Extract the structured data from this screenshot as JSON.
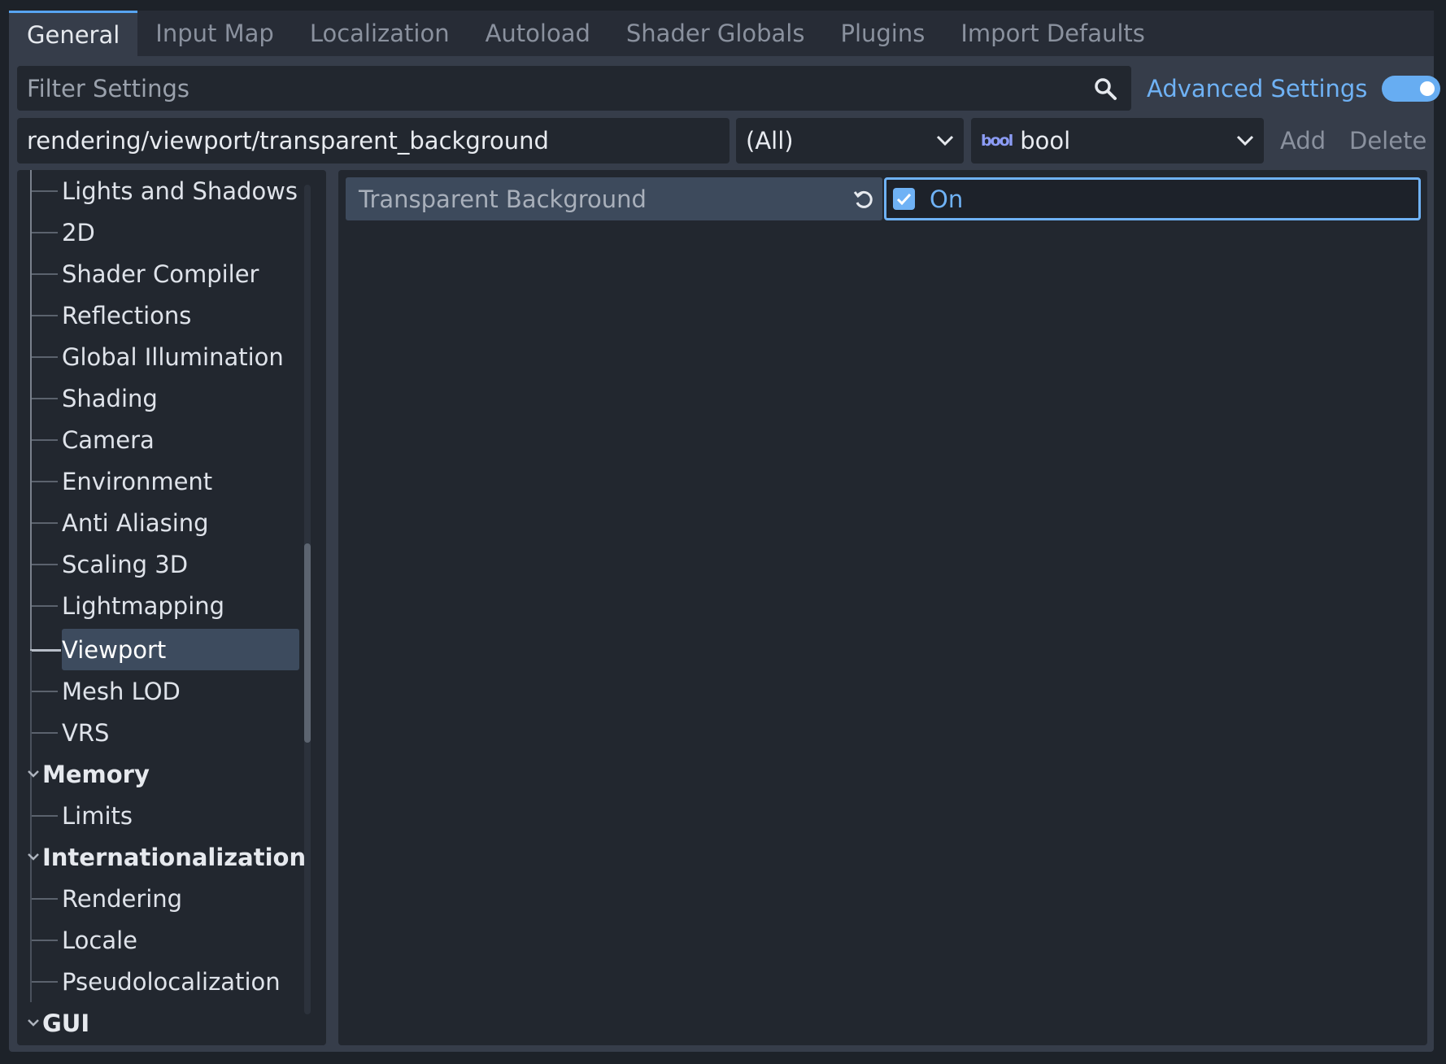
{
  "tabs": [
    {
      "label": "General",
      "active": true
    },
    {
      "label": "Input Map"
    },
    {
      "label": "Localization"
    },
    {
      "label": "Autoload"
    },
    {
      "label": "Shader Globals"
    },
    {
      "label": "Plugins"
    },
    {
      "label": "Import Defaults"
    }
  ],
  "filter": {
    "placeholder": "Filter Settings",
    "icon": "search-icon"
  },
  "advanced": {
    "label": "Advanced Settings",
    "enabled": true
  },
  "path": {
    "value": "rendering/viewport/transparent_background"
  },
  "feature_select": {
    "value": "(All)"
  },
  "type_select": {
    "icon_text": "bool",
    "value": "bool"
  },
  "buttons": {
    "add": "Add",
    "delete": "Delete"
  },
  "tree": {
    "items": [
      {
        "label": "Lights and Shadows"
      },
      {
        "label": "2D"
      },
      {
        "label": "Shader Compiler"
      },
      {
        "label": "Reflections"
      },
      {
        "label": "Global Illumination"
      },
      {
        "label": "Shading"
      },
      {
        "label": "Camera"
      },
      {
        "label": "Environment"
      },
      {
        "label": "Anti Aliasing"
      },
      {
        "label": "Scaling 3D"
      },
      {
        "label": "Lightmapping"
      },
      {
        "label": "Viewport",
        "selected": true
      },
      {
        "label": "Mesh LOD"
      },
      {
        "label": "VRS"
      }
    ],
    "memory": {
      "label": "Memory",
      "items": [
        {
          "label": "Limits"
        }
      ]
    },
    "i18n": {
      "label": "Internationalization",
      "items": [
        {
          "label": "Rendering"
        },
        {
          "label": "Locale"
        },
        {
          "label": "Pseudolocalization"
        }
      ]
    },
    "gui": {
      "label": "GUI"
    }
  },
  "property": {
    "name": "Transparent Background",
    "value_label": "On",
    "checked": true
  },
  "colors": {
    "accent": "#6fb2f5",
    "panel": "#22272f",
    "selected": "#3d4b5e"
  }
}
